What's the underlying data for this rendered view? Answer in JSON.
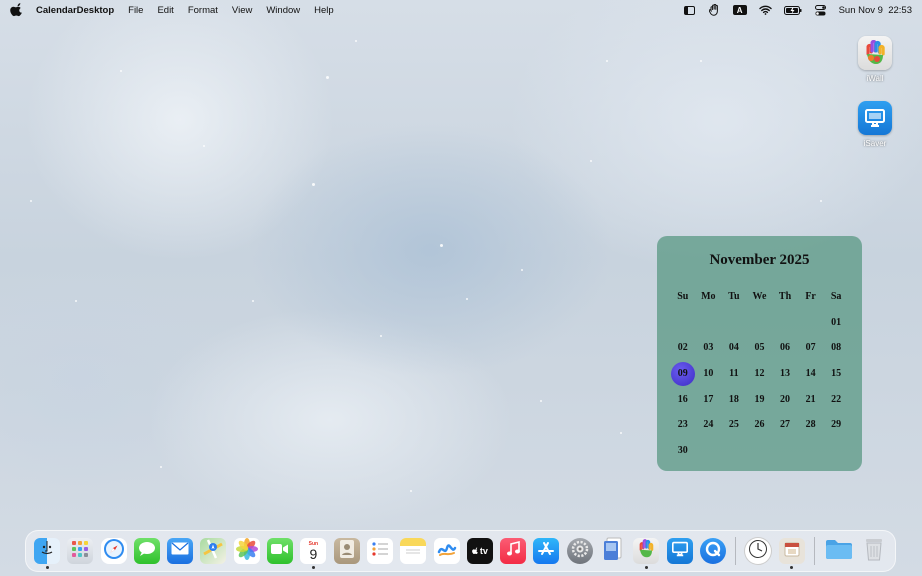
{
  "menubar": {
    "app_name": "CalendarDesktop",
    "menus": [
      "File",
      "Edit",
      "Format",
      "View",
      "Window",
      "Help"
    ],
    "status": {
      "keyboard_badge": "A",
      "datetime": "Sun Nov 9  22:53"
    },
    "status_icons": [
      "sidebar-icon",
      "hand-icon",
      "keyboard-input-icon",
      "wifi-icon",
      "battery-icon",
      "control-center-icon"
    ]
  },
  "desktop_icons": [
    {
      "label": "iWall",
      "icon": "hand-paint-icon"
    },
    {
      "label": "iSaver",
      "icon": "monitor-icon"
    }
  ],
  "calendar": {
    "title": "November 2025",
    "weekdays": [
      "Su",
      "Mo",
      "Tu",
      "We",
      "Th",
      "Fr",
      "Sa"
    ],
    "weeks": [
      [
        "",
        "",
        "",
        "",
        "",
        "",
        "01"
      ],
      [
        "02",
        "03",
        "04",
        "05",
        "06",
        "07",
        "08"
      ],
      [
        "09",
        "10",
        "11",
        "12",
        "13",
        "14",
        "15"
      ],
      [
        "16",
        "17",
        "18",
        "19",
        "20",
        "21",
        "22"
      ],
      [
        "23",
        "24",
        "25",
        "26",
        "27",
        "28",
        "29"
      ],
      [
        "30",
        "",
        "",
        "",
        "",
        "",
        ""
      ]
    ],
    "today": "09",
    "highlight_color": "#4b3ad8",
    "background_color": "#5a9a84"
  },
  "dock": {
    "items": [
      {
        "name": "finder",
        "icon": "finder-icon",
        "running": true
      },
      {
        "name": "launchpad",
        "icon": "launchpad-icon",
        "running": false
      },
      {
        "name": "safari",
        "icon": "safari-icon",
        "running": false
      },
      {
        "name": "messages",
        "icon": "messages-icon",
        "running": false
      },
      {
        "name": "mail",
        "icon": "mail-icon",
        "running": false
      },
      {
        "name": "maps",
        "icon": "maps-icon",
        "running": false
      },
      {
        "name": "photos",
        "icon": "photos-icon",
        "running": false
      },
      {
        "name": "facetime",
        "icon": "facetime-icon",
        "running": false
      },
      {
        "name": "calendar",
        "icon": "calendar-icon",
        "running": true,
        "month": "Sun",
        "day": "9"
      },
      {
        "name": "contacts",
        "icon": "contacts-icon",
        "running": false
      },
      {
        "name": "reminders",
        "icon": "reminders-icon",
        "running": false
      },
      {
        "name": "notes",
        "icon": "notes-icon",
        "running": false
      },
      {
        "name": "freeform",
        "icon": "freeform-icon",
        "running": false
      },
      {
        "name": "tv",
        "icon": "apple-tv-icon",
        "running": false,
        "text": "tv"
      },
      {
        "name": "music",
        "icon": "music-icon",
        "running": false
      },
      {
        "name": "app-store",
        "icon": "app-store-icon",
        "running": false
      },
      {
        "name": "system-settings",
        "icon": "gear-icon",
        "running": false
      },
      {
        "name": "preview",
        "icon": "preview-icon",
        "running": false
      },
      {
        "name": "iwall",
        "icon": "hand-paint-icon",
        "running": true
      },
      {
        "name": "isaver",
        "icon": "monitor-icon",
        "running": false
      },
      {
        "name": "quicktime",
        "icon": "quicktime-icon",
        "running": false
      }
    ],
    "recent": [
      {
        "name": "clock",
        "icon": "clock-icon",
        "running": false
      },
      {
        "name": "calendar-desktop",
        "icon": "calendar-desktop-icon",
        "running": true
      }
    ],
    "right": [
      {
        "name": "downloads-folder",
        "icon": "folder-icon"
      },
      {
        "name": "trash",
        "icon": "trash-icon"
      }
    ]
  }
}
